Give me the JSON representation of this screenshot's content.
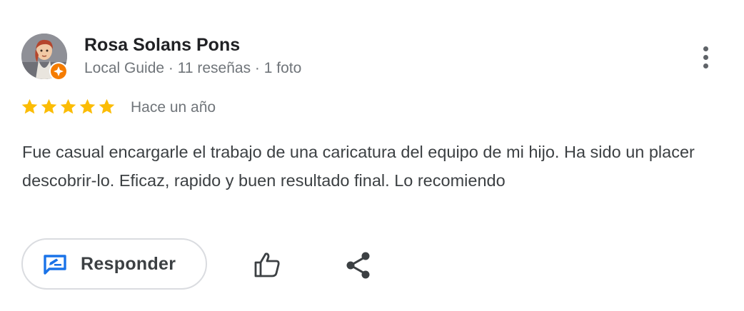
{
  "review": {
    "author": {
      "name": "Rosa Solans Pons",
      "meta": "Local Guide · 11 reseñas · 1 foto"
    },
    "rating": 5,
    "rating_max": 5,
    "date": "Hace un año",
    "text": "Fue casual encargarle el trabajo de una caricatura del equipo de mi hijo. Ha sido un placer descobrir-lo. Eficaz, rapido y buen resultado final. Lo recomiendo"
  },
  "actions": {
    "reply_label": "Responder"
  },
  "colors": {
    "star": "#fbbc04",
    "reply_icon": "#1a73e8",
    "badge": "#f57c00"
  }
}
